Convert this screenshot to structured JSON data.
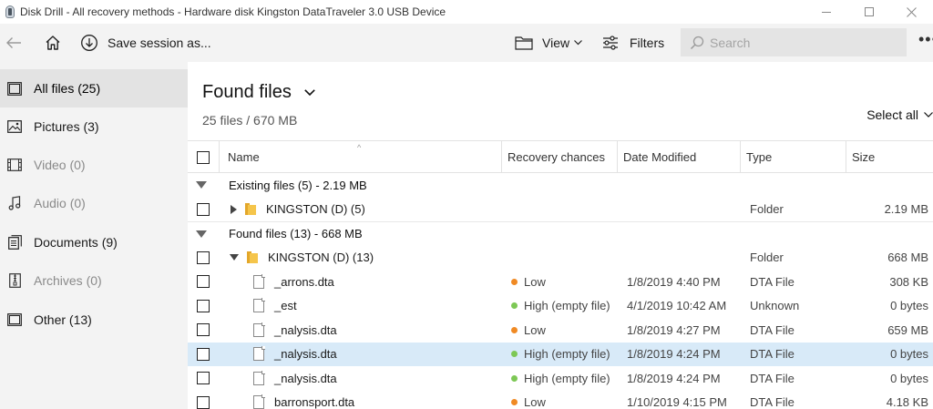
{
  "window": {
    "title": "Disk Drill - All recovery methods - Hardware disk Kingston DataTraveler 3.0 USB Device"
  },
  "toolbar": {
    "save_label": "Save session as...",
    "view_label": "View",
    "filters_label": "Filters",
    "search_placeholder": "Search",
    "more_label": "•••"
  },
  "sidebar": {
    "items": [
      {
        "label": "All files (25)",
        "icon": "all-files-icon",
        "active": true,
        "enabled": true
      },
      {
        "label": "Pictures (3)",
        "icon": "pictures-icon",
        "active": false,
        "enabled": true
      },
      {
        "label": "Video (0)",
        "icon": "video-icon",
        "active": false,
        "enabled": false
      },
      {
        "label": "Audio (0)",
        "icon": "audio-icon",
        "active": false,
        "enabled": false
      },
      {
        "label": "Documents (9)",
        "icon": "documents-icon",
        "active": false,
        "enabled": true
      },
      {
        "label": "Archives (0)",
        "icon": "archives-icon",
        "active": false,
        "enabled": false
      },
      {
        "label": "Other (13)",
        "icon": "other-icon",
        "active": false,
        "enabled": true
      }
    ]
  },
  "main": {
    "title": "Found files",
    "subtitle": "25 files / 670 MB",
    "select_all": "Select all"
  },
  "table": {
    "columns": {
      "name": "Name",
      "recovery": "Recovery chances",
      "date": "Date Modified",
      "type": "Type",
      "size": "Size"
    },
    "groups": [
      {
        "label": "Existing files (5) - 2.19 MB",
        "rows": [
          {
            "kind": "folder",
            "expander": "collapsed",
            "name": "KINGSTON (D) (5)",
            "recovery": "",
            "recovery_color": "",
            "date": "",
            "type": "Folder",
            "size": "2.19 MB",
            "selected": false
          }
        ]
      },
      {
        "label": "Found files (13) - 668 MB",
        "rows": [
          {
            "kind": "folder",
            "expander": "expanded",
            "name": "KINGSTON (D) (13)",
            "recovery": "",
            "recovery_color": "",
            "date": "",
            "type": "Folder",
            "size": "668 MB",
            "selected": false
          },
          {
            "kind": "file",
            "name": "_arrons.dta",
            "recovery": "Low",
            "recovery_color": "#f08a24",
            "date": "1/8/2019 4:40 PM",
            "type": "DTA File",
            "size": "308 KB",
            "selected": false
          },
          {
            "kind": "file",
            "name": "_est",
            "recovery": "High (empty file)",
            "recovery_color": "#7dc855",
            "date": "4/1/2019 10:42 AM",
            "type": "Unknown",
            "size": "0 bytes",
            "selected": false
          },
          {
            "kind": "file",
            "name": "_nalysis.dta",
            "recovery": "Low",
            "recovery_color": "#f08a24",
            "date": "1/8/2019 4:27 PM",
            "type": "DTA File",
            "size": "659 MB",
            "selected": false
          },
          {
            "kind": "file",
            "name": "_nalysis.dta",
            "recovery": "High (empty file)",
            "recovery_color": "#7dc855",
            "date": "1/8/2019 4:24 PM",
            "type": "DTA File",
            "size": "0 bytes",
            "selected": true
          },
          {
            "kind": "file",
            "name": "_nalysis.dta",
            "recovery": "High (empty file)",
            "recovery_color": "#7dc855",
            "date": "1/8/2019 4:24 PM",
            "type": "DTA File",
            "size": "0 bytes",
            "selected": false
          },
          {
            "kind": "file",
            "name": "barronsport.dta",
            "recovery": "Low",
            "recovery_color": "#f08a24",
            "date": "1/10/2019 4:15 PM",
            "type": "DTA File",
            "size": "4.18 KB",
            "selected": false
          }
        ]
      }
    ]
  }
}
